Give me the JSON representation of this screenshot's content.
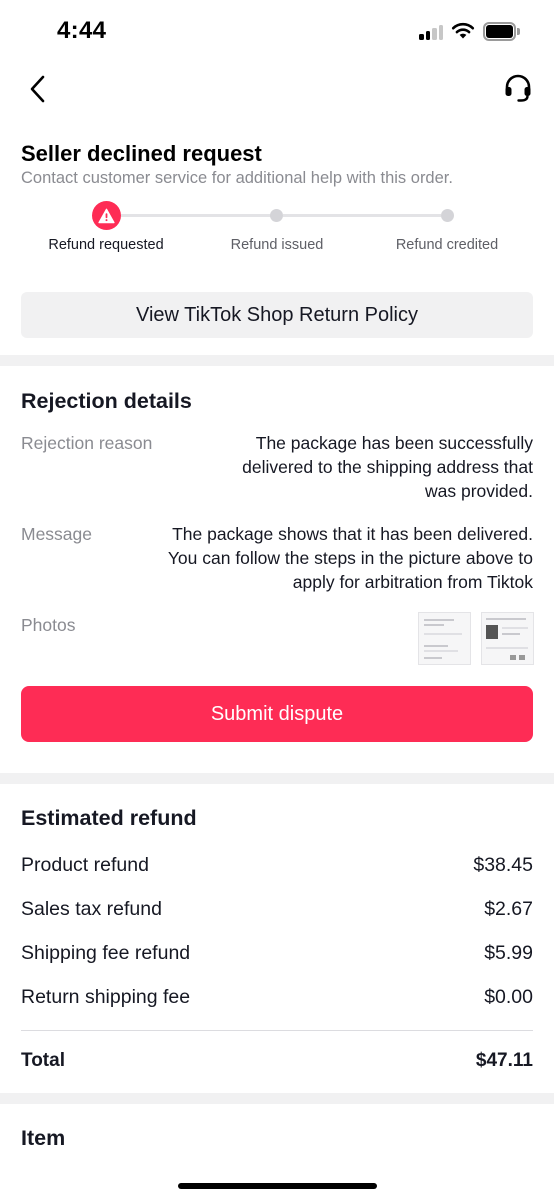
{
  "status_bar": {
    "time": "4:44"
  },
  "nav": {
    "back_icon": "chevron-left-icon",
    "support_icon": "headset-icon"
  },
  "header": {
    "title": "Seller declined request",
    "subtitle": "Contact customer service for additional help with this order."
  },
  "progress": {
    "current_step": 0,
    "steps": [
      {
        "label": "Refund requested",
        "status": "warning"
      },
      {
        "label": "Refund issued",
        "status": "pending"
      },
      {
        "label": "Refund credited",
        "status": "pending"
      }
    ]
  },
  "policy_button": {
    "label": "View TikTok Shop Return Policy"
  },
  "rejection": {
    "title": "Rejection details",
    "reason_label": "Rejection reason",
    "reason_lines": [
      "The package has been successfully",
      "delivered to the shipping address that",
      "was provided."
    ],
    "message_label": "Message",
    "message_lines": [
      "The package shows that it has been delivered.",
      "You can follow the steps in the picture above to",
      "apply for arbitration from Tiktok"
    ],
    "photos_label": "Photos",
    "photo_count": 2,
    "dispute_label": "Submit dispute"
  },
  "estimated_refund": {
    "title": "Estimated refund",
    "rows": [
      {
        "label": "Product refund",
        "value": "$38.45"
      },
      {
        "label": "Sales tax refund",
        "value": "$2.67"
      },
      {
        "label": "Shipping fee refund",
        "value": "$5.99"
      },
      {
        "label": "Return shipping fee",
        "value": "$0.00"
      }
    ],
    "total_label": "Total",
    "total_value": "$47.11"
  },
  "item": {
    "title": "Item"
  },
  "colors": {
    "accent": "#fe2c55",
    "text_primary": "#161823",
    "text_secondary": "#8a8b91",
    "band": "#f1f1f2"
  }
}
